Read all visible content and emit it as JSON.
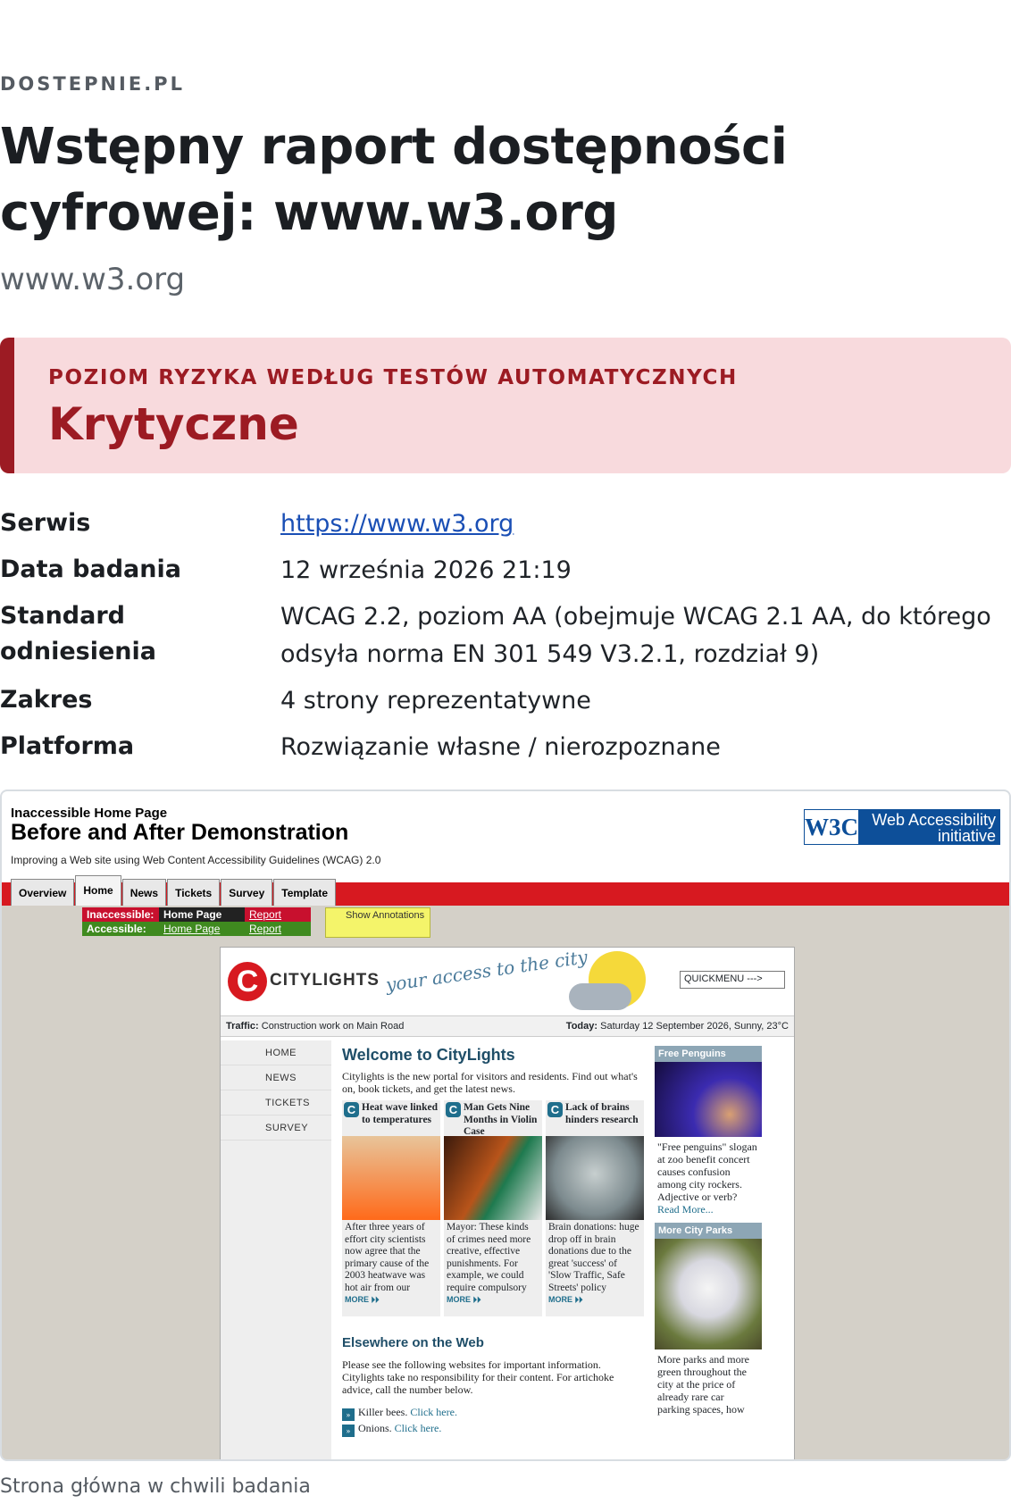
{
  "header": {
    "kicker": "DOSTEPNIE.PL",
    "title": "Wstępny raport dostępności cyfrowej: www.w3.org",
    "subtitle": "www.w3.org"
  },
  "risk": {
    "label": "POZIOM RYZYKA WEDŁUG TESTÓW AUTOMATYCZNYCH",
    "value": "Krytyczne",
    "color": "#9c1b23"
  },
  "meta": [
    {
      "key": "Serwis",
      "value": "https://www.w3.org"
    },
    {
      "key": "Data badania",
      "value": "12 września 2026 21:19"
    },
    {
      "key": "Standard odniesienia",
      "value": "WCAG 2.2, poziom AA (obejmuje WCAG 2.1 AA, do którego odsyła norma EN 301 549 V3.2.1, rozdział 9)"
    },
    {
      "key": "Zakres",
      "value": "4 strony reprezentatywne"
    },
    {
      "key": "Platforma",
      "value": "Rozwiązanie własne / nierozpoznane"
    }
  ],
  "screenshot": {
    "header_small": "Inaccessible Home Page",
    "header_big": "Before and After Demonstration",
    "header_sub": "Improving a Web site using Web Content Accessibility Guidelines (WCAG) 2.0",
    "w3c_logo": "W3C",
    "w3c_text": "Web Accessibility initiative",
    "tabs": [
      "Overview",
      "Home",
      "News",
      "Tickets",
      "Survey",
      "Template"
    ],
    "inaccessible_label": "Inaccessible:",
    "accessible_label": "Accessible:",
    "home_page": "Home Page",
    "report": "Report",
    "annotations": "Show Annotations",
    "site_name": "CITYLIGHTS",
    "tagline": "your access to the city",
    "quickmenu": "QUICKMENU --->",
    "traffic_label": "Traffic:",
    "traffic_text": "Construction work on Main Road",
    "today_label": "Today:",
    "today_text": "Saturday 12 September 2026, Sunny, 23°C",
    "nav": [
      "HOME",
      "NEWS",
      "TICKETS",
      "SURVEY"
    ],
    "welcome": "Welcome to CityLights",
    "welcome_text": "Citylights is the new portal for visitors and residents. Find out what's on, book tickets, and get the latest news.",
    "cards": [
      {
        "title": "Heat wave linked to temperatures",
        "text": "After three years of effort city scientists now agree that the primary cause of the 2003 heatwave was hot air from our",
        "more": "MORE ⏵⏵"
      },
      {
        "title": "Man Gets Nine Months in Violin Case",
        "text": "Mayor: These kinds of crimes need more creative, effective punishments. For example, we could require compulsory",
        "more": "MORE ⏵⏵"
      },
      {
        "title": "Lack of brains hinders research",
        "text": "Brain donations: huge drop off in brain donations due to the great 'success' of 'Slow Traffic, Safe Streets' policy",
        "more": "MORE ⏵⏵"
      }
    ],
    "side1_title": "Free Penguins",
    "side1_text": "\"Free penguins\" slogan at zoo benefit concert causes confusion among city rockers. Adjective or verb?",
    "side1_link": "Read More...",
    "side2_title": "More City Parks",
    "side2_text": "More parks and more green throughout the city at the price of already rare car parking spaces, how",
    "elsewhere": "Elsewhere on the Web",
    "elsewhere_text": "Please see the following websites for important information. Citylights take no responsibility for their content. For artichoke advice, call the number below.",
    "link1_text": "Killer bees.",
    "link2_text": "Onions.",
    "click_here": "Click here."
  },
  "caption": "Strona główna w chwili badania"
}
